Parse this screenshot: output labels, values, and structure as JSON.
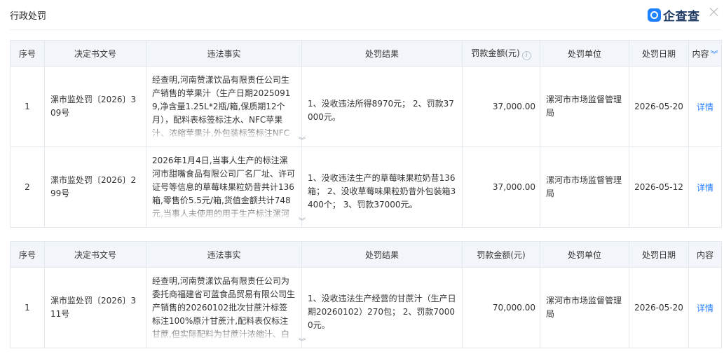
{
  "panel": {
    "title": "行政处罚",
    "brand": "企查查"
  },
  "table1": {
    "headers": {
      "no": "序号",
      "doc": "决定书文号",
      "fact": "违法事实",
      "result": "处罚结果",
      "amount": "罚款金额(元)",
      "unit": "处罚单位",
      "date": "处罚日期",
      "content": "内容"
    },
    "rows": [
      {
        "no": "1",
        "doc": "漯市监处罚〔2026〕309号",
        "fact": "经查明,河南赞漾饮品有限责任公司生产销售的苹果汁（生产日期20250919,净含量1.25L*2瓶/箱,保质期12个月），配料表标签标注水、NFC苹果汁、浓缩苹果汁,外包装标签标注NFC字样加大",
        "result": "1、没收违法所得8970元； 2、罚款37000元。",
        "amount": "37,000.00",
        "unit": "漯河市市场监督管理局",
        "date": "2026-05-20",
        "link": "详情"
      },
      {
        "no": "2",
        "doc": "漯市监处罚〔2026〕299号",
        "fact": "2026年1月4日,当事人生产的标注漯河市甜嘴食品有限公司厂名厂址、许可证号等信息的草莓味果粒奶昔共计136箱,零售价5.5元/箱,货值金额共计748元,当事人未使用的用于生产标注漯河市甜嘴",
        "result": "1、没收违法生产的草莓味果粒奶昔136箱； 2、没收草莓味果粒奶昔外包装箱3400个； 3、罚款37000元。",
        "amount": "37,000.00",
        "unit": "漯河市市场监督管理局",
        "date": "2026-05-12",
        "link": "详情"
      }
    ]
  },
  "table2": {
    "headers": {
      "no": "序号",
      "doc": "决定书文号",
      "fact": "违法事实",
      "result": "处罚结果",
      "amount": "罚款金额(元)",
      "unit": "处罚单位",
      "date": "处罚日期",
      "content": "内容"
    },
    "rows": [
      {
        "no": "1",
        "doc": "漯市监处罚〔2026〕311号",
        "fact": "经查明,河南赞漾饮品有限责任公司为委托商福建省可蓝食品贸易有限公司生产销售的20260102批次甘蔗汁标签标注100%原汁甘蔗汁,配料表仅标注甘蔗,但实际配料为甘蔗汁浓缩汁、白糖",
        "result": "1、没收违法生产经营的甘蔗汁（生产日期20260102）270包； 2、罚款70000元。",
        "amount": "70,000.00",
        "unit": "漯河市市场监督管理局",
        "date": "2026-05-20",
        "link": "详情"
      }
    ]
  }
}
